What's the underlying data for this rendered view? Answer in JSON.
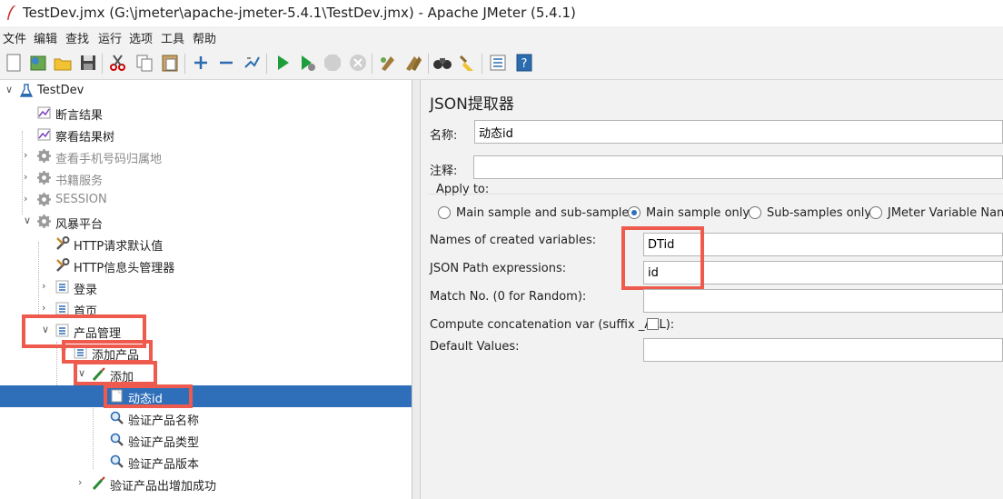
{
  "window": {
    "title": "TestDev.jmx (G:\\jmeter\\apache-jmeter-5.4.1\\TestDev.jmx) - Apache JMeter (5.4.1)"
  },
  "menu": [
    "文件",
    "编辑",
    "查找",
    "运行",
    "选项",
    "工具",
    "帮助"
  ],
  "toolbar": [
    "new-icon",
    "templates-icon",
    "open-icon",
    "save-icon",
    "cut-icon",
    "copy-icon",
    "paste-icon",
    "expand-icon",
    "collapse-icon",
    "toggle-icon",
    "start-icon",
    "start-no-pause-icon",
    "stop-icon",
    "shutdown-icon",
    "clear-icon",
    "clear-all-icon",
    "search-icon",
    "reset-search-icon",
    "function-helper-icon",
    "help-icon"
  ],
  "tree": [
    {
      "label": "TestDev",
      "icon": "flask-icon",
      "depth": 0,
      "expander": "open",
      "disabled": false,
      "selected": false
    },
    {
      "label": "断言结果",
      "icon": "listener-icon",
      "depth": 1,
      "expander": "none",
      "disabled": false,
      "selected": false
    },
    {
      "label": "察看结果树",
      "icon": "listener-icon",
      "depth": 1,
      "expander": "none",
      "disabled": false,
      "selected": false
    },
    {
      "label": "查看手机号码归属地",
      "icon": "gear-icon",
      "depth": 1,
      "expander": "closed",
      "disabled": true,
      "selected": false
    },
    {
      "label": "书籍服务",
      "icon": "gear-icon",
      "depth": 1,
      "expander": "closed",
      "disabled": true,
      "selected": false
    },
    {
      "label": "SESSION",
      "icon": "gear-icon",
      "depth": 1,
      "expander": "closed",
      "disabled": true,
      "selected": false
    },
    {
      "label": "风暴平台",
      "icon": "gear-icon",
      "depth": 1,
      "expander": "open",
      "disabled": false,
      "selected": false
    },
    {
      "label": "HTTP请求默认值",
      "icon": "wrench-icon",
      "depth": 2,
      "expander": "none",
      "disabled": false,
      "selected": false
    },
    {
      "label": "HTTP信息头管理器",
      "icon": "wrench-icon",
      "depth": 2,
      "expander": "none",
      "disabled": false,
      "selected": false
    },
    {
      "label": "登录",
      "icon": "controller-icon",
      "depth": 2,
      "expander": "closed",
      "disabled": false,
      "selected": false
    },
    {
      "label": "首页",
      "icon": "controller-icon",
      "depth": 2,
      "expander": "closed",
      "disabled": false,
      "selected": false
    },
    {
      "label": "产品管理",
      "icon": "controller-icon",
      "depth": 2,
      "expander": "open",
      "disabled": false,
      "selected": false
    },
    {
      "label": "添加产品",
      "icon": "controller-icon",
      "depth": 3,
      "expander": "open",
      "disabled": false,
      "selected": false
    },
    {
      "label": "添加",
      "icon": "sampler-icon",
      "depth": 4,
      "expander": "open",
      "disabled": false,
      "selected": false
    },
    {
      "label": "动态id",
      "icon": "extractor-icon",
      "depth": 5,
      "expander": "none",
      "disabled": false,
      "selected": true
    },
    {
      "label": "验证产品名称",
      "icon": "magnifier-icon",
      "depth": 5,
      "expander": "none",
      "disabled": false,
      "selected": false
    },
    {
      "label": "验证产品类型",
      "icon": "magnifier-icon",
      "depth": 5,
      "expander": "none",
      "disabled": false,
      "selected": false
    },
    {
      "label": "验证产品版本",
      "icon": "magnifier-icon",
      "depth": 5,
      "expander": "none",
      "disabled": false,
      "selected": false
    },
    {
      "label": "验证产品出增加成功",
      "icon": "sampler-icon",
      "depth": 4,
      "expander": "closed",
      "disabled": false,
      "selected": false
    }
  ],
  "panel": {
    "title": "JSON提取器",
    "name_label": "名称:",
    "name_value": "动态id",
    "comment_label": "注释:",
    "comment_value": "",
    "apply_to_label": "Apply to:",
    "apply_options": [
      {
        "label": "Main sample and sub-samples",
        "checked": false
      },
      {
        "label": "Main sample only",
        "checked": true
      },
      {
        "label": "Sub-samples only",
        "checked": false
      },
      {
        "label": "JMeter Variable Name",
        "checked": false
      }
    ],
    "var_names_label": "Names of created variables:",
    "var_names_value": "DTid",
    "json_path_label": "JSON Path expressions:",
    "json_path_value": "id",
    "match_no_label": "Match No. (0 for Random):",
    "match_no_value": "",
    "concat_label": "Compute concatenation var (suffix _ALL):",
    "concat_checked": false,
    "default_label": "Default Values:",
    "default_value": ""
  },
  "highlight_color": "#ee5a4d",
  "selection_color": "#2f6fba"
}
